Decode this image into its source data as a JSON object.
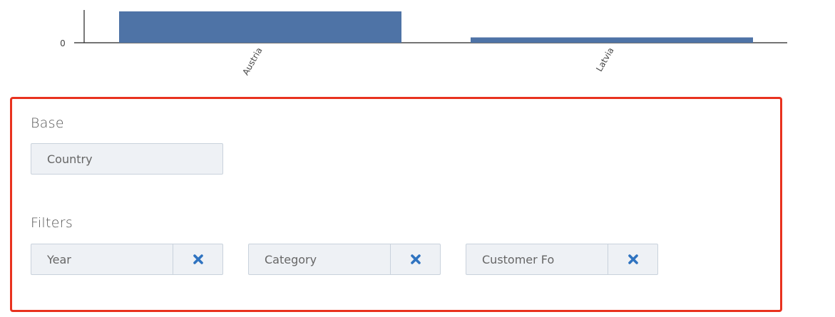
{
  "chart_data": {
    "type": "bar",
    "categories": [
      "Austria",
      "Latvia"
    ],
    "values": [
      100,
      17
    ],
    "title": "",
    "xlabel": "",
    "ylabel": "",
    "y_ticks": [
      "0"
    ],
    "ylim": [
      0,
      100
    ],
    "color": "#4e73a6"
  },
  "base": {
    "label": "Base",
    "value": "Country"
  },
  "filters": {
    "label": "Filters",
    "items": [
      {
        "label": "Year",
        "remove_icon": "close-icon"
      },
      {
        "label": "Category",
        "remove_icon": "close-icon"
      },
      {
        "label": "Customer Fo",
        "remove_icon": "close-icon"
      }
    ]
  },
  "colors": {
    "highlight_border": "#e8321f",
    "remove_icon": "#2f73c0",
    "chip_background": "#eef1f5"
  }
}
